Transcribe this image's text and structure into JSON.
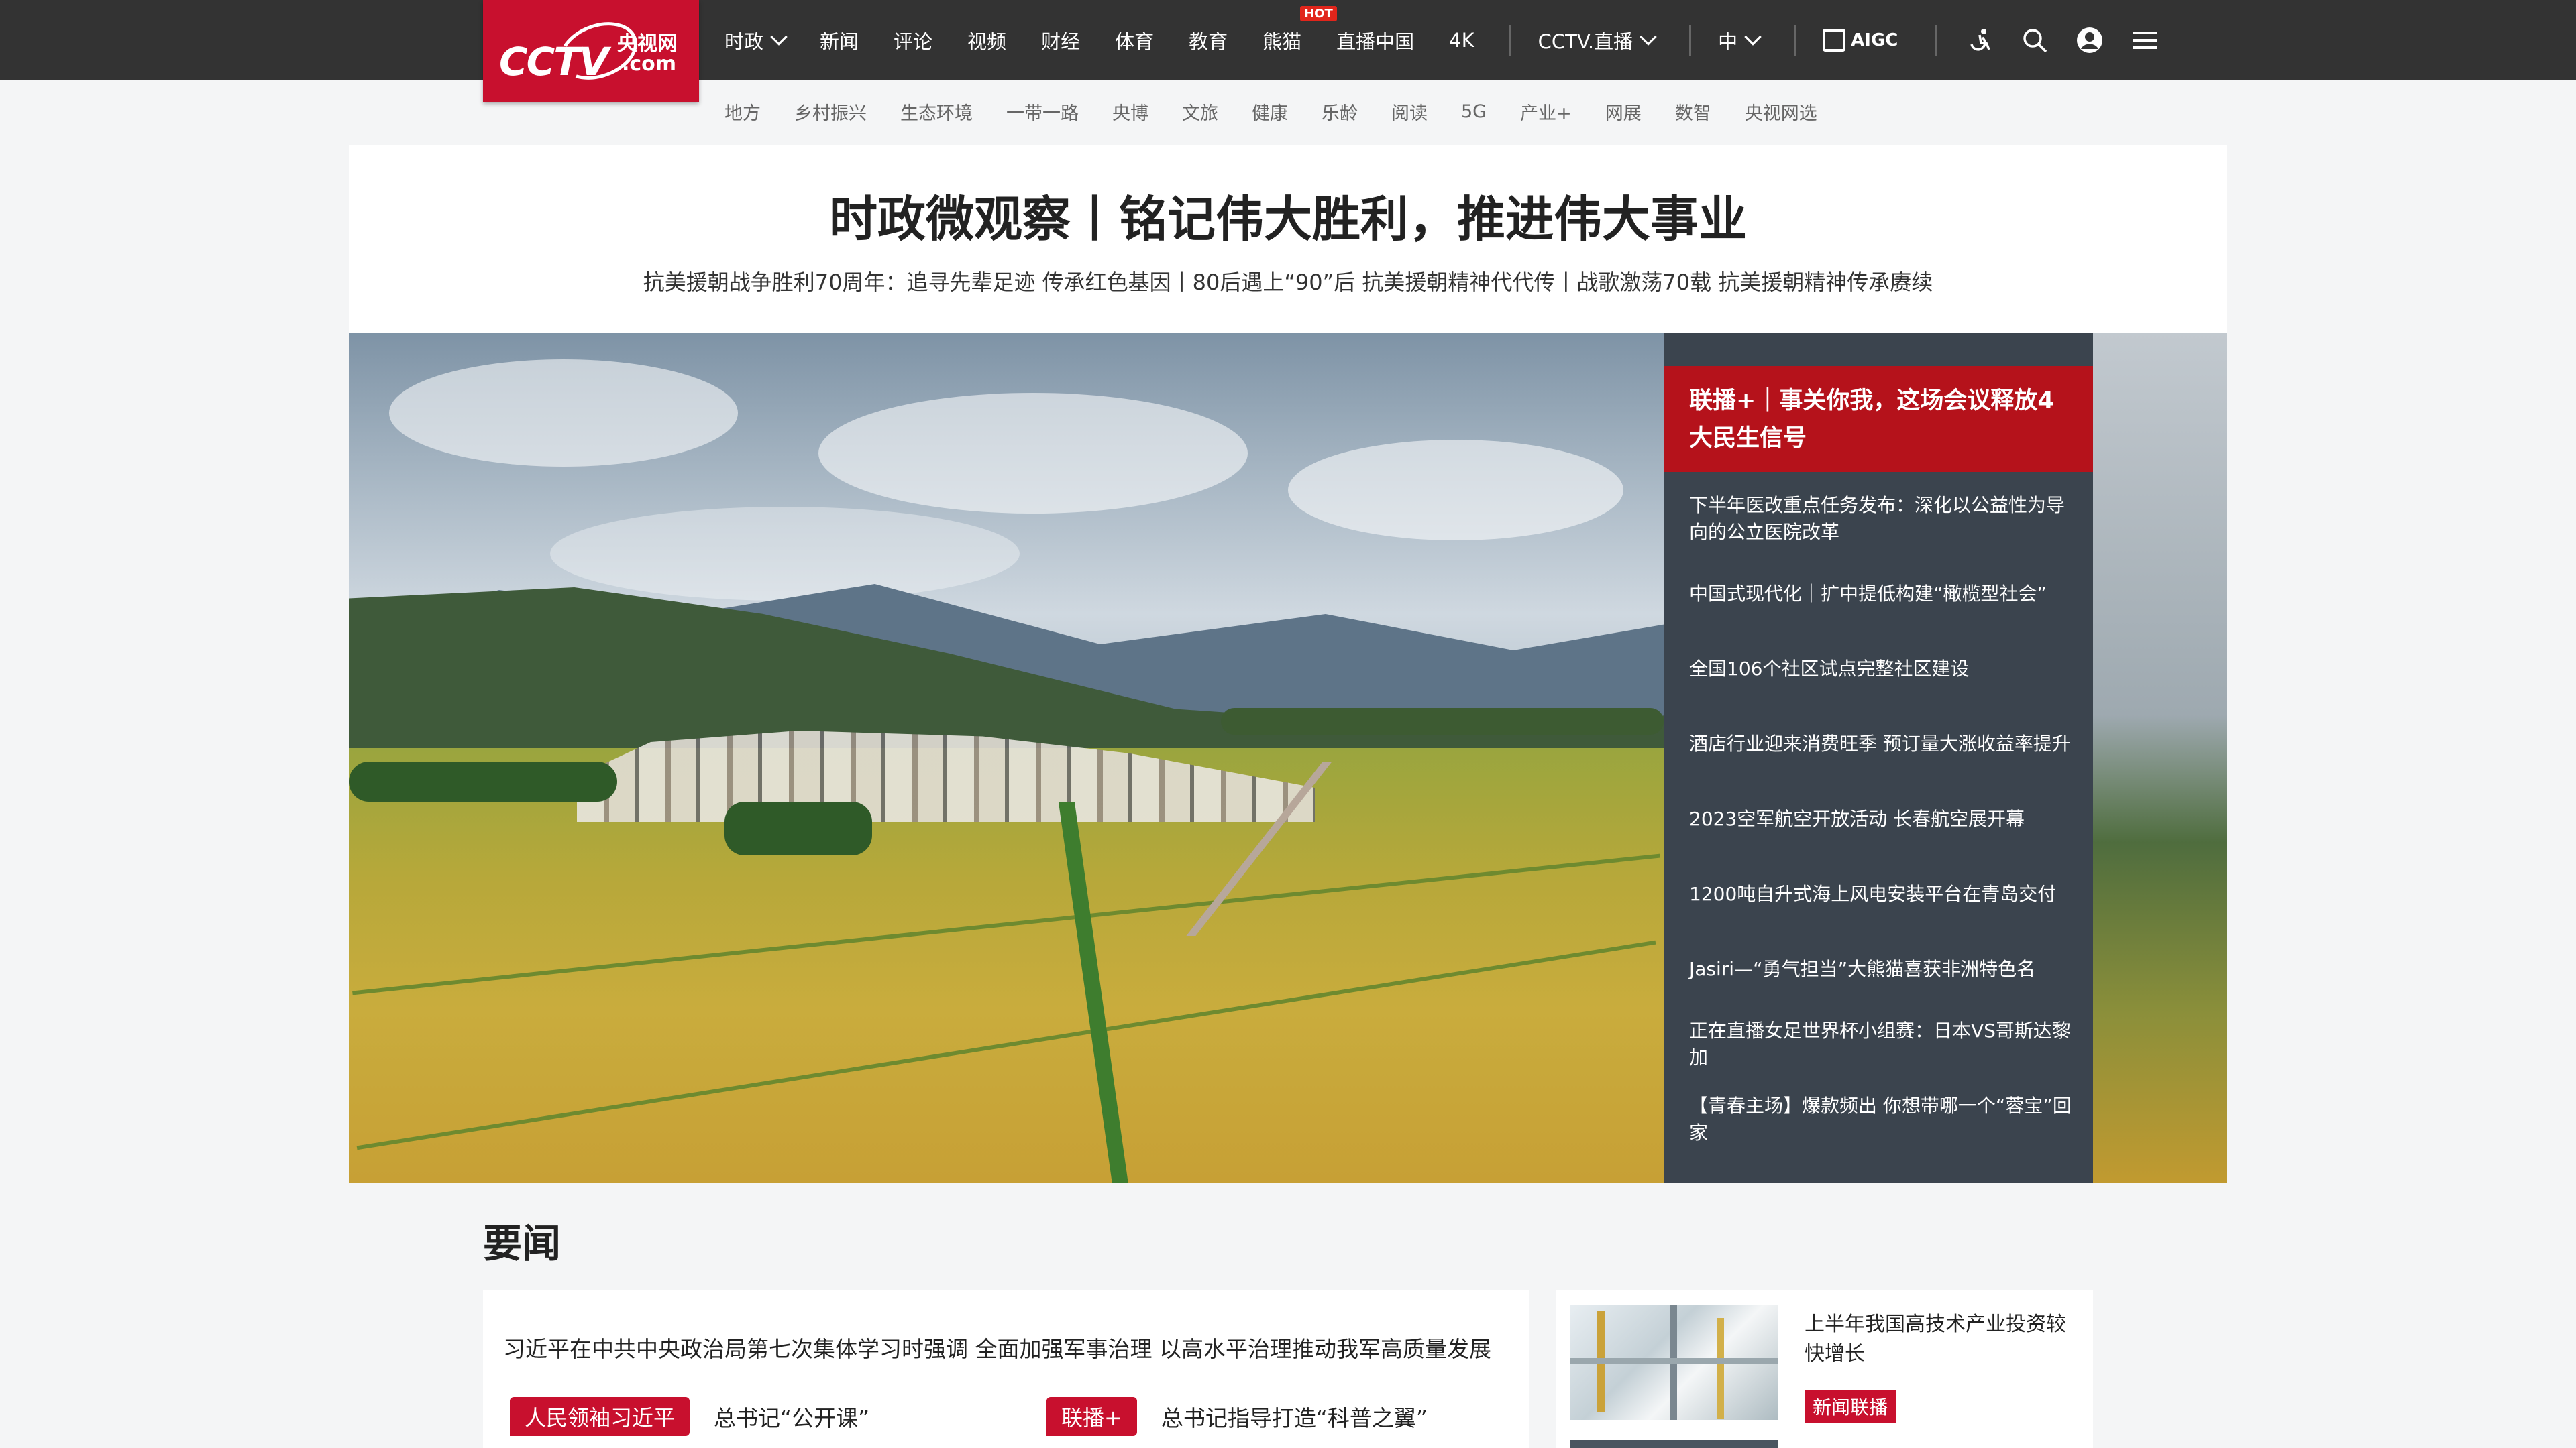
{
  "logo": {
    "main": "CCTV",
    "cn": "央视网",
    "com": ".com"
  },
  "nav": {
    "items": [
      "时政",
      "新闻",
      "评论",
      "视频",
      "财经",
      "体育",
      "教育",
      "熊猫",
      "直播中国",
      "4K"
    ],
    "hot_badge": "HOT",
    "live_label": "CCTV.直播",
    "lang_label": "中",
    "aigc_label": "AIGC"
  },
  "subnav": [
    "地方",
    "乡村振兴",
    "生态环境",
    "一带一路",
    "央博",
    "文旅",
    "健康",
    "乐龄",
    "阅读",
    "5G",
    "产业+",
    "网展",
    "数智",
    "央视网选"
  ],
  "headline": {
    "title": "时政微观察丨铭记伟大胜利，推进伟大事业",
    "links": "抗美援朝战争胜利70周年：追寻先辈足迹 传承红色基因丨80后遇上“90”后 抗美援朝精神代代传丨战歌激荡70载 抗美援朝精神传承赓续"
  },
  "hero": {
    "feature": "联播+｜事关你我，这场会议释放4大民生信号",
    "items": [
      "下半年医改重点任务发布：深化以公益性为导向的公立医院改革",
      "中国式现代化｜扩中提低构建“橄榄型社会”",
      "全国106个社区试点完整社区建设",
      "酒店行业迎来消费旺季 预订量大涨收益率提升",
      "2023空军航空开放活动 长春航空展开幕",
      "1200吨自升式海上风电安装平台在青岛交付",
      "Jasiri—“勇气担当”大熊猫喜获非洲特色名",
      "正在直播女足世界杯小组赛：日本VS哥斯达黎加",
      "【青春主场】爆款频出 你想带哪一个“蓉宝”回家"
    ]
  },
  "news": {
    "section_title": "要闻",
    "main": "习近平在中共中央政治局第七次集体学习时强调 全面加强军事治理 以高水平治理推动我军高质量发展",
    "tag1": "人民领袖习近平",
    "text1": "总书记“公开课”",
    "tag2": "联播+",
    "text2": "总书记指导打造“科普之翼”",
    "side_title": "上半年我国高技术产业投资较快增长",
    "side_tag": "新闻联播"
  },
  "colors": {
    "brand_red": "#c8102e",
    "topbar": "#333333",
    "hero_feature": "#b5121b"
  }
}
